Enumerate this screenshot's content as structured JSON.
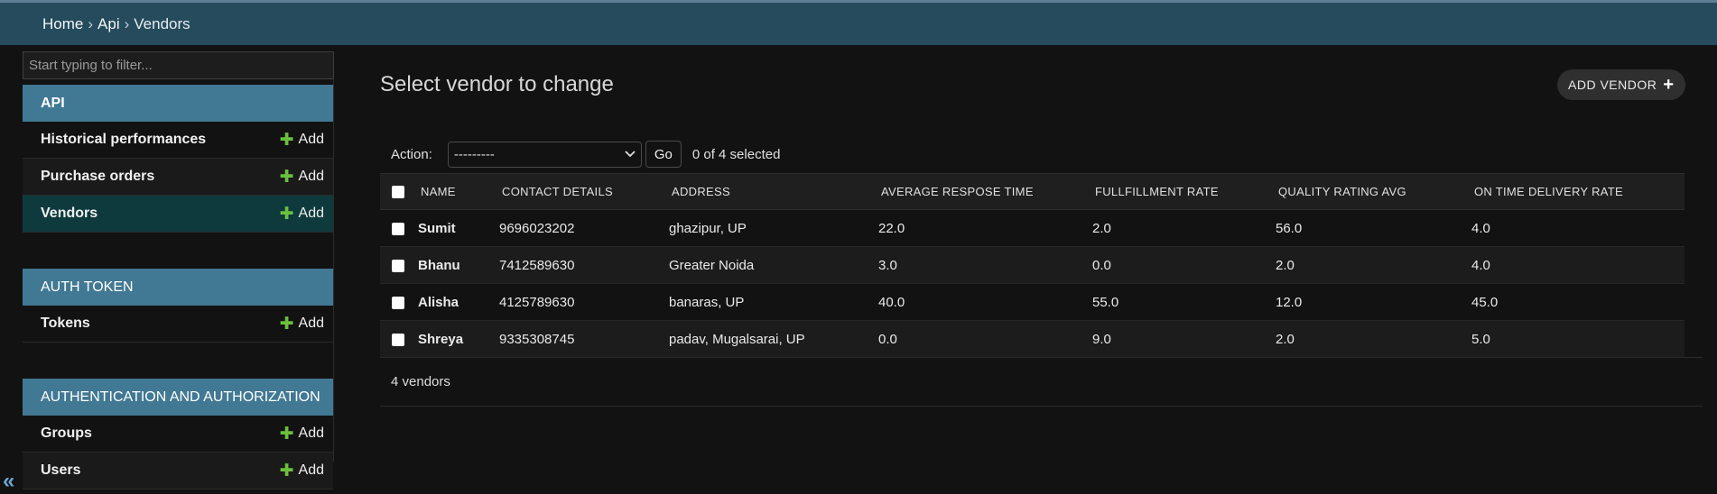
{
  "breadcrumbs": {
    "home": "Home",
    "sep1": "›",
    "app": "Api",
    "sep2": "›",
    "current": "Vendors"
  },
  "sidebar": {
    "filter_placeholder": "Start typing to filter...",
    "modules": [
      {
        "title": "API",
        "items": [
          {
            "label": "Historical performances",
            "add": "Add"
          },
          {
            "label": "Purchase orders",
            "add": "Add"
          },
          {
            "label": "Vendors",
            "add": "Add"
          }
        ]
      },
      {
        "title": "AUTH TOKEN",
        "items": [
          {
            "label": "Tokens",
            "add": "Add"
          }
        ]
      },
      {
        "title": "AUTHENTICATION AND AUTHORIZATION",
        "items": [
          {
            "label": "Groups",
            "add": "Add"
          },
          {
            "label": "Users",
            "add": "Add"
          }
        ]
      }
    ],
    "collapse_icon": "«"
  },
  "main": {
    "title": "Select vendor to change",
    "add_button": "ADD VENDOR",
    "add_button_icon": "+",
    "action_label": "Action:",
    "action_selected": "---------",
    "go_label": "Go",
    "selection_count": "0 of 4 selected",
    "columns": [
      "NAME",
      "CONTACT DETAILS",
      "ADDRESS",
      "AVERAGE RESPOSE TIME",
      "FULLFILLMENT RATE",
      "QUALITY RATING AVG",
      "ON TIME DELIVERY RATE"
    ],
    "rows": [
      [
        "Sumit",
        "9696023202",
        "ghazipur, UP",
        "22.0",
        "2.0",
        "56.0",
        "4.0"
      ],
      [
        "Bhanu",
        "7412589630",
        "Greater Noida",
        "3.0",
        "0.0",
        "2.0",
        "4.0"
      ],
      [
        "Alisha",
        "4125789630",
        "banaras, UP",
        "40.0",
        "55.0",
        "12.0",
        "45.0"
      ],
      [
        "Shreya",
        "9335308745",
        "padav, Mugalsarai, UP",
        "0.0",
        "9.0",
        "2.0",
        "5.0"
      ]
    ],
    "paginator": "4 vendors"
  },
  "colors": {
    "header": "#264b5d",
    "module_header": "#417893",
    "current_row": "#0e3a3d",
    "add_plus": "#6bbf3f"
  }
}
